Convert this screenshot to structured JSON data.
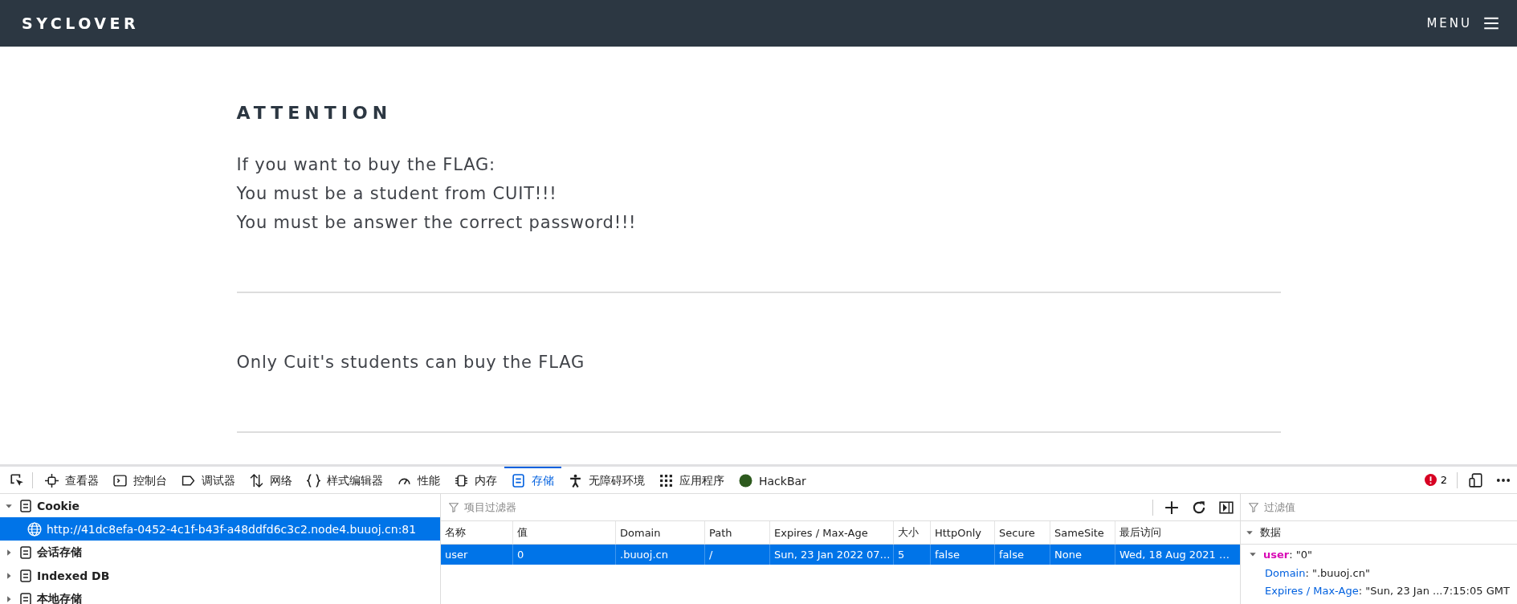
{
  "navbar": {
    "brand": "SYCLOVER",
    "menu_label": "MENU"
  },
  "content": {
    "heading": "ATTENTION",
    "lines": [
      "If you want to buy the FLAG:",
      "You must be a student from CUIT!!!",
      "You must be answer the correct password!!!"
    ],
    "notice": "Only Cuit's students can buy the FLAG"
  },
  "devtools": {
    "tabs": [
      {
        "label": "查看器",
        "kind": "inspector",
        "selected": false
      },
      {
        "label": "控制台",
        "kind": "console",
        "selected": false
      },
      {
        "label": "调试器",
        "kind": "debugger",
        "selected": false
      },
      {
        "label": "网络",
        "kind": "network",
        "selected": false
      },
      {
        "label": "样式编辑器",
        "kind": "style",
        "selected": false
      },
      {
        "label": "性能",
        "kind": "performance",
        "selected": false
      },
      {
        "label": "内存",
        "kind": "memory",
        "selected": false
      },
      {
        "label": "存储",
        "kind": "storage",
        "selected": true
      },
      {
        "label": "无障碍环境",
        "kind": "accessibility",
        "selected": false
      },
      {
        "label": "应用程序",
        "kind": "application",
        "selected": false
      },
      {
        "label": "HackBar",
        "kind": "hackbar",
        "selected": false
      }
    ],
    "error_count": "2",
    "tree": [
      {
        "label": "Cookie",
        "expanded": true,
        "selected": false,
        "children": [
          {
            "label": "http://41dc8efa-0452-4c1f-b43f-a48ddfd6c3c2.node4.buuoj.cn:81",
            "selected": true
          }
        ]
      },
      {
        "label": "会话存储",
        "expanded": false,
        "selected": false
      },
      {
        "label": "Indexed DB",
        "expanded": false,
        "selected": false
      },
      {
        "label": "本地存储",
        "expanded": false,
        "selected": false
      }
    ],
    "filter_placeholder": "项目过滤器",
    "table": {
      "columns": [
        "名称",
        "值",
        "Domain",
        "Path",
        "Expires / Max-Age",
        "大小",
        "HttpOnly",
        "Secure",
        "SameSite",
        "最后访问"
      ],
      "rows": [
        {
          "selected": true,
          "cells": [
            "user",
            "0",
            ".buuoj.cn",
            "/",
            "Sun, 23 Jan 2022 07…",
            "5",
            "false",
            "false",
            "None",
            "Wed, 18 Aug 2021 …"
          ]
        }
      ]
    },
    "sidebar": {
      "filter_placeholder": "过滤值",
      "section": "数据",
      "entry": {
        "key": "user",
        "value": ": \"0\"",
        "expanded": true,
        "properties": [
          {
            "key": "Domain",
            "value": ": \".buuoj.cn\""
          },
          {
            "key": "Expires / Max-Age",
            "value": ": \"Sun, 23 Jan ...7:15:05 GMT"
          }
        ]
      }
    }
  }
}
